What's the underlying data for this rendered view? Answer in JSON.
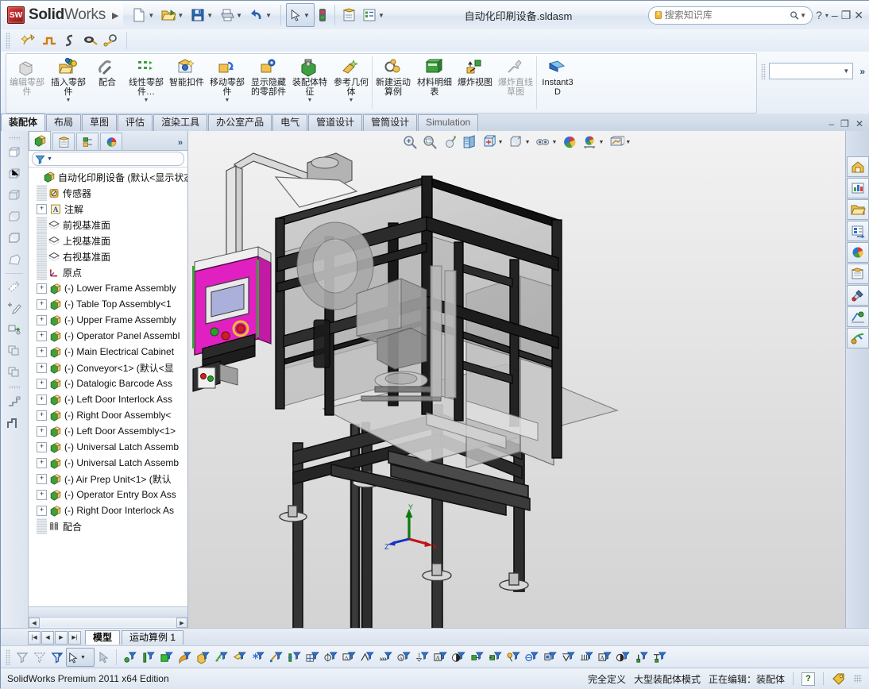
{
  "app": {
    "brand_solid": "Solid",
    "brand_works": "Works",
    "logo_text": "SW",
    "document_title": "自动化印刷设备.sldasm",
    "edition": "SolidWorks Premium 2011 x64 Edition"
  },
  "search": {
    "placeholder": "搜索知识库",
    "value": ""
  },
  "window_buttons": {
    "help": "?",
    "help_caret": "▾",
    "minimize": "–",
    "restore": "❐",
    "close": "✕"
  },
  "quick_access": [
    {
      "name": "new-document",
      "label": "新建"
    },
    {
      "name": "open-document",
      "label": "打开"
    },
    {
      "name": "save-document",
      "label": "保存"
    },
    {
      "name": "print-document",
      "label": "打印"
    },
    {
      "name": "undo",
      "label": "撤消"
    },
    {
      "name": "select",
      "label": "选择"
    },
    {
      "name": "rebuild",
      "label": "重建模型"
    },
    {
      "name": "options",
      "label": "选项"
    },
    {
      "name": "customize-menu",
      "label": "自定义"
    }
  ],
  "mini_toolbar": [
    {
      "name": "assembly-wizard",
      "label": "智能扣件向导"
    },
    {
      "name": "profile-s1",
      "label": "路径 1"
    },
    {
      "name": "profile-s2",
      "label": "路径 2"
    },
    {
      "name": "belt-chain",
      "label": "皮带/链"
    },
    {
      "name": "gear-mate",
      "label": "齿轮配合"
    }
  ],
  "ribbon": {
    "commands": [
      {
        "name": "edit-component",
        "label": "编辑零部件",
        "disabled": true,
        "dropdown": false
      },
      {
        "name": "insert-components",
        "label": "插入零部件",
        "disabled": false,
        "dropdown": true
      },
      {
        "name": "mate",
        "label": "配合",
        "disabled": false,
        "dropdown": false
      },
      {
        "name": "linear-component-pattern",
        "label": "线性零部件…",
        "disabled": false,
        "dropdown": true
      },
      {
        "name": "smart-fasteners",
        "label": "智能扣件",
        "disabled": false,
        "dropdown": false
      },
      {
        "name": "move-component",
        "label": "移动零部件",
        "disabled": false,
        "dropdown": true
      },
      {
        "name": "show-hidden-components",
        "label": "显示隐藏的零部件",
        "disabled": false,
        "dropdown": false
      },
      {
        "name": "assembly-features",
        "label": "装配体特征",
        "disabled": false,
        "dropdown": true
      },
      {
        "name": "reference-geometry",
        "label": "参考几何体",
        "disabled": false,
        "dropdown": true
      },
      {
        "name": "new-motion-study",
        "label": "新建运动算例",
        "disabled": false,
        "dropdown": false
      },
      {
        "name": "bill-of-materials",
        "label": "材料明细表",
        "disabled": false,
        "dropdown": false
      },
      {
        "name": "exploded-view",
        "label": "爆炸视图",
        "disabled": false,
        "dropdown": false
      },
      {
        "name": "explode-line-sketch",
        "label": "爆炸直线草图",
        "disabled": true,
        "dropdown": false
      },
      {
        "name": "instant3d",
        "label": "Instant3D",
        "disabled": false,
        "dropdown": false
      }
    ],
    "config_value": ""
  },
  "tabs": [
    {
      "name": "tab-assembly",
      "label": "装配体",
      "active": true
    },
    {
      "name": "tab-layout",
      "label": "布局",
      "active": false
    },
    {
      "name": "tab-sketch",
      "label": "草图",
      "active": false
    },
    {
      "name": "tab-evaluate",
      "label": "评估",
      "active": false
    },
    {
      "name": "tab-render-tools",
      "label": "渲染工具",
      "active": false
    },
    {
      "name": "tab-office",
      "label": "办公室产品",
      "active": false
    },
    {
      "name": "tab-electrical",
      "label": "电气",
      "active": false
    },
    {
      "name": "tab-routing",
      "label": "管道设计",
      "active": false
    },
    {
      "name": "tab-tubing",
      "label": "管筒设计",
      "active": false
    },
    {
      "name": "tab-simulation",
      "label": "Simulation",
      "active": false
    }
  ],
  "doc_window_buttons": {
    "minimize": "–",
    "restore": "❐",
    "close": "✕"
  },
  "tree_panel": {
    "tabs": [
      {
        "name": "feature-manager-tab",
        "active": true
      },
      {
        "name": "property-manager-tab",
        "active": false
      },
      {
        "name": "configuration-manager-tab",
        "active": false
      },
      {
        "name": "display-manager-tab",
        "active": false
      }
    ],
    "expand_chevron": "»",
    "filter_placeholder": "",
    "items": [
      {
        "name": "tree-root",
        "label": "自动化印刷设备  (默认<显示状态",
        "icon": "assembly",
        "indent": 0,
        "expander": "none",
        "dots": false
      },
      {
        "name": "tree-item-sensors",
        "label": "传感器",
        "icon": "sensor",
        "indent": 1,
        "expander": "none",
        "dots": true
      },
      {
        "name": "tree-item-annotations",
        "label": "注解",
        "icon": "annot",
        "indent": 1,
        "expander": "plus",
        "dots": true
      },
      {
        "name": "tree-item-front-plane",
        "label": "前视基准面",
        "icon": "plane",
        "indent": 1,
        "expander": "none",
        "dots": true
      },
      {
        "name": "tree-item-top-plane",
        "label": "上视基准面",
        "icon": "plane",
        "indent": 1,
        "expander": "none",
        "dots": true
      },
      {
        "name": "tree-item-right-plane",
        "label": "右视基准面",
        "icon": "plane",
        "indent": 1,
        "expander": "none",
        "dots": true
      },
      {
        "name": "tree-item-origin",
        "label": "原点",
        "icon": "origin",
        "indent": 1,
        "expander": "none",
        "dots": true
      },
      {
        "name": "tree-item-lower-frame",
        "label": "(-) Lower Frame Assembly",
        "icon": "comp",
        "indent": 1,
        "expander": "plus",
        "dots": true
      },
      {
        "name": "tree-item-table-top",
        "label": "(-) Table Top Assembly<1",
        "icon": "comp",
        "indent": 1,
        "expander": "plus",
        "dots": true
      },
      {
        "name": "tree-item-upper-frame",
        "label": "(-) Upper Frame Assembly",
        "icon": "comp",
        "indent": 1,
        "expander": "plus",
        "dots": true
      },
      {
        "name": "tree-item-operator-panel",
        "label": "(-) Operator Panel Assembl",
        "icon": "comp",
        "indent": 1,
        "expander": "plus",
        "dots": true
      },
      {
        "name": "tree-item-main-electrical",
        "label": "(-) Main Electrical Cabinet",
        "icon": "comp",
        "indent": 1,
        "expander": "plus",
        "dots": true
      },
      {
        "name": "tree-item-conveyor",
        "label": "(-) Conveyor<1> (默认<显",
        "icon": "comp",
        "indent": 1,
        "expander": "plus",
        "dots": true
      },
      {
        "name": "tree-item-datalogic",
        "label": "(-) Datalogic Barcode Ass",
        "icon": "comp",
        "indent": 1,
        "expander": "plus",
        "dots": true
      },
      {
        "name": "tree-item-left-interlock",
        "label": "(-) Left Door Interlock Ass",
        "icon": "comp",
        "indent": 1,
        "expander": "plus",
        "dots": true
      },
      {
        "name": "tree-item-right-door",
        "label": "(-) Right Door Assembly<",
        "icon": "comp",
        "indent": 1,
        "expander": "plus",
        "dots": true
      },
      {
        "name": "tree-item-left-door",
        "label": "(-) Left Door Assembly<1>",
        "icon": "comp",
        "indent": 1,
        "expander": "plus",
        "dots": true
      },
      {
        "name": "tree-item-universal-latch-1",
        "label": "(-) Universal Latch Assemb",
        "icon": "comp",
        "indent": 1,
        "expander": "plus",
        "dots": true
      },
      {
        "name": "tree-item-universal-latch-2",
        "label": "(-) Universal Latch Assemb",
        "icon": "comp",
        "indent": 1,
        "expander": "plus",
        "dots": true
      },
      {
        "name": "tree-item-air-prep",
        "label": "(-) Air Prep Unit<1> (默认",
        "icon": "comp",
        "indent": 1,
        "expander": "plus",
        "dots": true
      },
      {
        "name": "tree-item-operator-entry",
        "label": "(-) Operator Entry Box Ass",
        "icon": "comp",
        "indent": 1,
        "expander": "plus",
        "dots": true
      },
      {
        "name": "tree-item-right-interlock",
        "label": "(-) Right Door Interlock As",
        "icon": "comp",
        "indent": 1,
        "expander": "plus",
        "dots": true
      },
      {
        "name": "tree-item-mates",
        "label": "配合",
        "icon": "mates",
        "indent": 1,
        "expander": "none",
        "dots": true
      }
    ]
  },
  "view_toolbar": [
    {
      "name": "zoom-to-fit-icon",
      "label": "整屏显示全图"
    },
    {
      "name": "zoom-to-area-icon",
      "label": "局部放大"
    },
    {
      "name": "previous-view-icon",
      "label": "上一视图"
    },
    {
      "name": "section-view-icon",
      "label": "剖面视图"
    },
    {
      "name": "view-orientation-icon",
      "label": "视图定向",
      "dropdown": true
    },
    {
      "name": "display-style-icon",
      "label": "显示样式",
      "dropdown": true
    },
    {
      "name": "hide-show-items-icon",
      "label": "隐藏/显示项目",
      "dropdown": true
    },
    {
      "name": "edit-appearance-icon",
      "label": "编辑外观"
    },
    {
      "name": "apply-scene-icon",
      "label": "应用布景",
      "dropdown": true
    },
    {
      "name": "view-settings-icon",
      "label": "视图设定",
      "dropdown": true
    }
  ],
  "left_toolbar": [
    {
      "name": "wireframe-icon"
    },
    {
      "name": "hidden-lines-visible-icon"
    },
    {
      "name": "hidden-lines-removed-icon"
    },
    {
      "name": "shaded-icon"
    },
    {
      "name": "shaded-with-edges-icon"
    },
    {
      "name": "perspective-icon"
    },
    {
      "name": "shadows-icon"
    },
    {
      "name": "add-sketch-icon"
    },
    {
      "name": "insert-component-icon"
    },
    {
      "name": "copy-with-mates-icon"
    },
    {
      "name": "pattern-icon"
    },
    {
      "name": "assembly-feature-icon"
    },
    {
      "name": "motion-study-icon"
    }
  ],
  "task_pane": [
    {
      "name": "solidworks-resources-icon"
    },
    {
      "name": "design-library-icon"
    },
    {
      "name": "file-explorer-icon"
    },
    {
      "name": "search-results-icon"
    },
    {
      "name": "view-palette-icon"
    },
    {
      "name": "appearances-scenes-icon"
    },
    {
      "name": "custom-properties-icon"
    },
    {
      "name": "drawing-views-icon"
    },
    {
      "name": "simulation-icon"
    }
  ],
  "triad": {
    "x_label": "X",
    "y_label": "Y",
    "z_label": "Z"
  },
  "sheet_tabs": {
    "nav": {
      "first": "|◀",
      "prev": "◀",
      "next": "▶",
      "last": "▶|"
    },
    "tabs": [
      {
        "name": "sheet-tab-model",
        "label": "模型",
        "active": true
      },
      {
        "name": "sheet-tab-motion",
        "label": "运动算例 1",
        "active": false
      }
    ]
  },
  "filter_toolbar": {
    "left_tools": [
      {
        "name": "filter-icon"
      },
      {
        "name": "clear-filters-icon"
      },
      {
        "name": "toggle-filters-icon"
      }
    ],
    "selection_tools": [
      {
        "name": "select-arrow-icon"
      },
      {
        "name": "select-other-icon"
      }
    ],
    "filters": [
      {
        "name": "filter-vertices-icon"
      },
      {
        "name": "filter-edges-icon"
      },
      {
        "name": "filter-faces-icon"
      },
      {
        "name": "filter-surface-bodies-icon"
      },
      {
        "name": "filter-solid-bodies-icon"
      },
      {
        "name": "filter-axes-icon"
      },
      {
        "name": "filter-planes-icon"
      },
      {
        "name": "filter-sketch-points-icon"
      },
      {
        "name": "filter-sketch-segments-icon"
      },
      {
        "name": "filter-midpoints-icon"
      },
      {
        "name": "filter-center-marks-icon"
      },
      {
        "name": "filter-centerlines-icon"
      },
      {
        "name": "filter-dimensions-icon"
      },
      {
        "name": "filter-surface-finish-icon"
      },
      {
        "name": "filter-welds-icon"
      },
      {
        "name": "filter-weld-beads-icon"
      },
      {
        "name": "filter-datum-icon"
      },
      {
        "name": "filter-cosmetic-threads-icon"
      },
      {
        "name": "filter-blocks-icon"
      },
      {
        "name": "filter-dowel-symbols-icon"
      },
      {
        "name": "filter-notes-icon"
      },
      {
        "name": "filter-balloons-icon"
      },
      {
        "name": "filter-tables-icon"
      },
      {
        "name": "filter-hole-callouts-icon"
      },
      {
        "name": "filter-annotations-icon"
      },
      {
        "name": "filter-datum-targets-icon"
      },
      {
        "name": "filter-letters-icon"
      },
      {
        "name": "filter-appearance-icon"
      },
      {
        "name": "filter-connection-point-icon"
      },
      {
        "name": "filter-route-point-icon"
      }
    ]
  },
  "status_bar": {
    "edition": "SolidWorks Premium 2011 x64 Edition",
    "state": "完全定义",
    "mode": "大型装配体模式",
    "editing": "正在编辑：装配体",
    "help_glyph": "?",
    "tag_name": "tag-icon"
  },
  "colors": {
    "accent_blue": "#3b5a86",
    "panel_bg": "#dfe7f1",
    "graphics_bg_top": "#f2f2f2",
    "graphics_bg_bottom": "#d3d3d3",
    "hmi_panel": "#e020c0",
    "tree_text": "#0f0f0f"
  }
}
